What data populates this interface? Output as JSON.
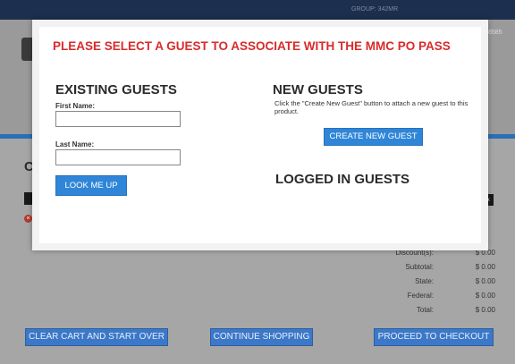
{
  "header": {
    "group_text": "GROUP: 342MR",
    "phone_fragment": "8585"
  },
  "page": {
    "cart_heading_fragment": "C"
  },
  "totals": [
    {
      "label": "Discount(s):",
      "value": "$ 0.00"
    },
    {
      "label": "Subtotal:",
      "value": "$ 0.00"
    },
    {
      "label": "State:",
      "value": "$ 0.00"
    },
    {
      "label": "Federal:",
      "value": "$ 0.00"
    },
    {
      "label": "Total:",
      "value": "$ 0.00"
    }
  ],
  "bottom_buttons": {
    "clear": "CLEAR CART AND START OVER",
    "continue": "CONTINUE SHOPPING",
    "checkout": "PROCEED TO CHECKOUT"
  },
  "modal": {
    "title": "PLEASE SELECT A GUEST TO ASSOCIATE WITH THE MMC PO PASS",
    "existing": {
      "heading": "EXISTING GUESTS",
      "first_name_label": "First Name:",
      "first_name_value": "",
      "last_name_label": "Last Name:",
      "last_name_value": "",
      "lookup_button": "LOOK ME UP"
    },
    "new": {
      "heading": "NEW GUESTS",
      "hint": "Click the \"Create New Guest\" button to attach a new guest to this product.",
      "create_button": "CREATE NEW GUEST"
    },
    "logged_in": {
      "heading": "LOGGED IN GUESTS"
    }
  },
  "colors": {
    "accent_red": "#d92b2b",
    "button_blue": "#2f86d8",
    "header_navy": "#1c2f4f"
  }
}
